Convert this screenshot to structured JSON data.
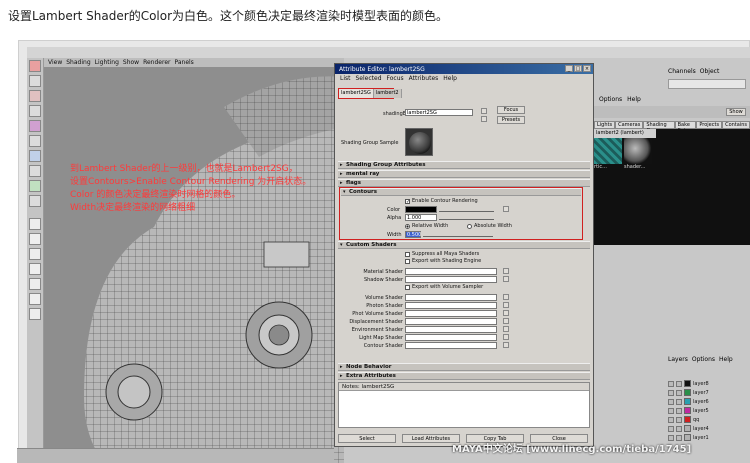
{
  "caption": "设置Lambert Shader的Color为白色。这个颜色决定最终渲染时模型表面的颜色。",
  "maya": {
    "panel_menu": [
      "View",
      "Shading",
      "Lighting",
      "Show",
      "Renderer",
      "Panels"
    ],
    "annotation_lines": [
      "到Lambert Shader的上一级别，也就是Lambert2SG，",
      "设置Contours>Enable Contour Rendering 为开启状态。",
      "Color 的颜色决定最终渲染时网格的颜色。",
      "Width决定最终渲染的网络粗细"
    ]
  },
  "attribute_editor": {
    "title": "Attribute Editor: lambert2SG",
    "menu": [
      "List",
      "Selected",
      "Focus",
      "Attributes",
      "Help"
    ],
    "tabs": [
      "lambert2SG",
      "lambert2"
    ],
    "shading_engine_label": "shadingEngine:",
    "shading_engine_value": "lambert2SG",
    "focus_label": "Focus",
    "presets_label": "Presets",
    "sample_label": "Shading Group Sample",
    "sections": {
      "shading_group_attributes": "Shading Group Attributes",
      "mental_ray": "mental ray",
      "flags": "flags",
      "contours": "Contours",
      "custom_shaders": "Custom Shaders",
      "node_behavior": "Node Behavior",
      "extra_attributes": "Extra Attributes"
    },
    "contours": {
      "enable_label": "Enable Contour Rendering",
      "color_label": "Color",
      "alpha_label": "Alpha",
      "alpha_value": "1.000",
      "relative_width_label": "Relative Width",
      "absolute_width_label": "Absolute Width",
      "width_label": "Width",
      "width_value": "0.500"
    },
    "custom_shaders": {
      "suppress_label": "Suppress all Maya Shaders",
      "export_shading_label": "Export with Shading Engine",
      "export_volume_label": "Export with Volume Sampler",
      "rows": [
        "Material Shader",
        "Shadow Shader",
        "Volume Shader",
        "Photon Shader",
        "Phot Volume Shader",
        "Displacement Shader",
        "Environment Shader",
        "Light Map Shader",
        "Contour Shader"
      ]
    },
    "notes_label": "Notes:  lambert2SG",
    "buttons": [
      "Select",
      "Load Attributes",
      "Copy Tab",
      "Close"
    ]
  },
  "hypershade": {
    "menu": [
      "Options",
      "Help"
    ],
    "show_label": "Show",
    "tabs": [
      "Lights",
      "Cameras",
      "Shading Groups",
      "Bake Sets",
      "Projects",
      "Contains"
    ],
    "swatch_title": "lambert2 (lambert)",
    "swatch_labels": [
      "rtic...",
      "shader..."
    ]
  },
  "channel_box": {
    "menu": [
      "Channels",
      "Object"
    ]
  },
  "layer_editor": {
    "menu": [
      "Layers",
      "Options",
      "Help"
    ],
    "layers": [
      {
        "name": "layer8",
        "color": "#111111"
      },
      {
        "name": "layer7",
        "color": "#2a8f4a"
      },
      {
        "name": "layer6",
        "color": "#2aa0b0"
      },
      {
        "name": "layer5",
        "color": "#c02aa0"
      },
      {
        "name": "qq",
        "color": "#d02020"
      },
      {
        "name": "layer4",
        "color": "#b0b0b0"
      },
      {
        "name": "layer1",
        "color": "#b0b0b0"
      }
    ]
  },
  "watermark": "MAYA中文论坛 [www.linecg.com/tieba/1745]",
  "colors": {
    "annotation": "#ff3a3a",
    "highlight_border": "#d02020",
    "titlebar": "#0a246a"
  }
}
